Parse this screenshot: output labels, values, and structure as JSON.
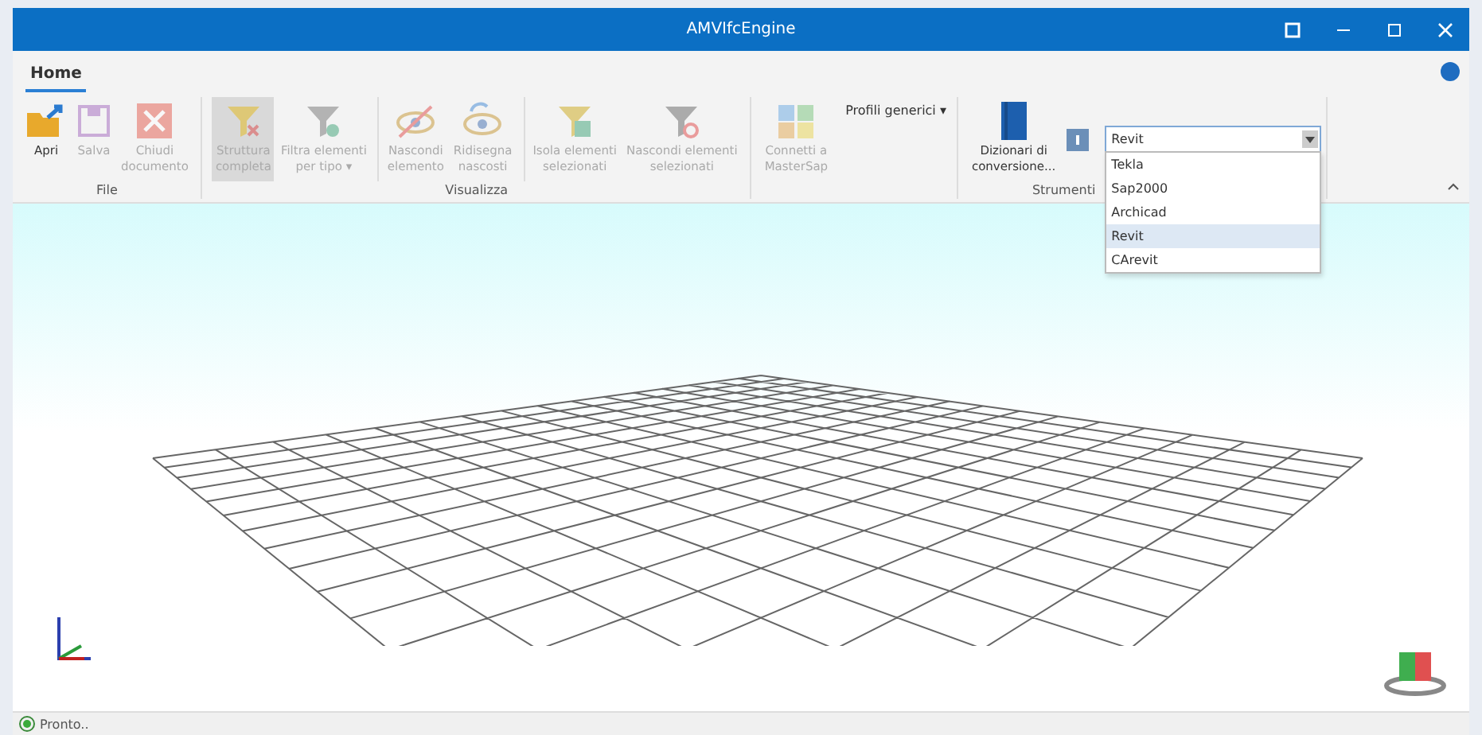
{
  "window": {
    "title": "AMVIfcEngine"
  },
  "tabs": [
    {
      "label": "Home",
      "selected": true
    }
  ],
  "groups": [
    {
      "label": "File",
      "sections": [
        {
          "buttons": [
            {
              "label": [
                "Apri"
              ],
              "disabled": false,
              "selected": false
            },
            {
              "label": [
                "Salva"
              ],
              "disabled": true,
              "selected": false
            },
            {
              "label": [
                "Chiudi",
                "documento"
              ],
              "disabled": true,
              "selected": false
            }
          ]
        }
      ]
    },
    {
      "label": "Visualizza",
      "sections": [
        {
          "buttons": [
            {
              "label": [
                "Struttura",
                "completa"
              ],
              "disabled": true,
              "selected": true
            },
            {
              "label": [
                "Filtra elementi",
                "per tipo ▾"
              ],
              "disabled": true,
              "selected": false
            }
          ]
        },
        {
          "buttons": [
            {
              "label": [
                "Nascondi",
                "elemento"
              ],
              "disabled": true,
              "selected": false
            },
            {
              "label": [
                "Ridisegna",
                "nascosti"
              ],
              "disabled": true,
              "selected": false
            }
          ]
        },
        {
          "buttons": [
            {
              "label": [
                "Isola elementi",
                "selezionati"
              ],
              "disabled": true,
              "selected": false
            },
            {
              "label": [
                "Nascondi elementi",
                "selezionati"
              ],
              "disabled": true,
              "selected": false
            }
          ]
        }
      ]
    },
    {
      "sections": [
        {
          "buttons": [
            {
              "label": [
                "Connetti a",
                "MasterSap"
              ],
              "disabled": true,
              "selected": false
            }
          ]
        }
      ],
      "menu_button": {
        "label": "Profili generici ▾"
      }
    },
    {
      "label": "Strumenti",
      "sections": [
        {
          "buttons": [
            {
              "label": [
                "Dizionari di",
                "conversione..."
              ],
              "disabled": false,
              "selected": false
            }
          ]
        }
      ],
      "icon_buttons": [
        {
          "kind": "help"
        }
      ],
      "combo": {
        "value": "Revit",
        "expanded": true,
        "options": [
          {
            "label": "Tekla",
            "selected": false
          },
          {
            "label": "Sap2000",
            "selected": false
          },
          {
            "label": "Archicad",
            "selected": false
          },
          {
            "label": "Revit",
            "selected": true
          },
          {
            "label": "CArevit",
            "selected": false
          }
        ]
      }
    }
  ],
  "status_bar": {
    "text": "Pronto.."
  }
}
